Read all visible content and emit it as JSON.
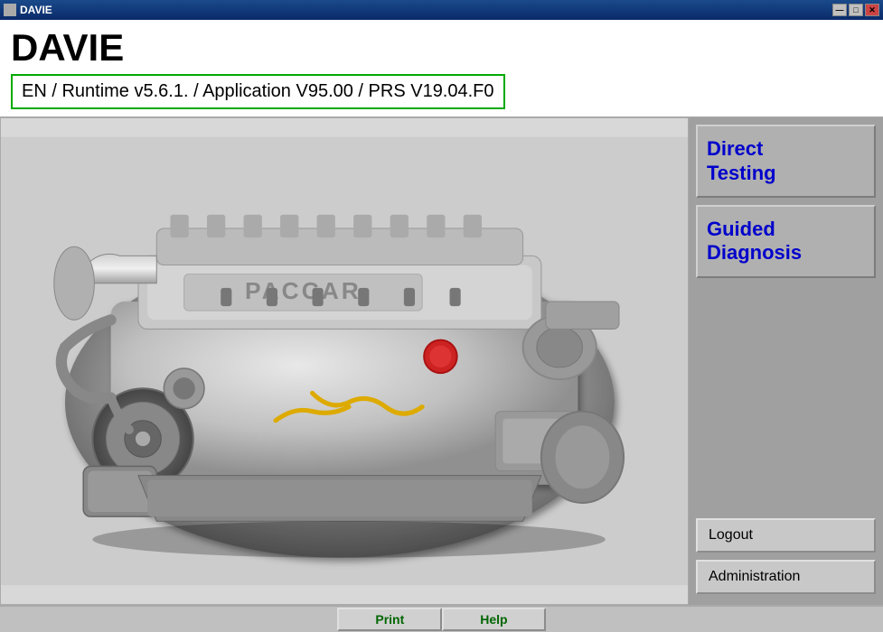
{
  "titlebar": {
    "title": "DAVIE",
    "controls": {
      "minimize": "—",
      "maximize": "□",
      "close": "✕"
    }
  },
  "header": {
    "app_title": "DAVIE",
    "version_label": "EN / Runtime v5.6.1. / Application V95.00 / PRS V19.04.F0"
  },
  "sidebar": {
    "btn_direct_testing": "Direct\nTesting",
    "btn_direct_testing_line1": "Direct",
    "btn_direct_testing_line2": "Testing",
    "btn_guided_diagnosis_line1": "Guided",
    "btn_guided_diagnosis_line2": "Diagnosis",
    "btn_logout": "Logout",
    "btn_administration": "Administration"
  },
  "bottom_bar": {
    "btn_print": "Print",
    "btn_help": "Help"
  },
  "engine": {
    "alt": "PACCAR Engine"
  }
}
